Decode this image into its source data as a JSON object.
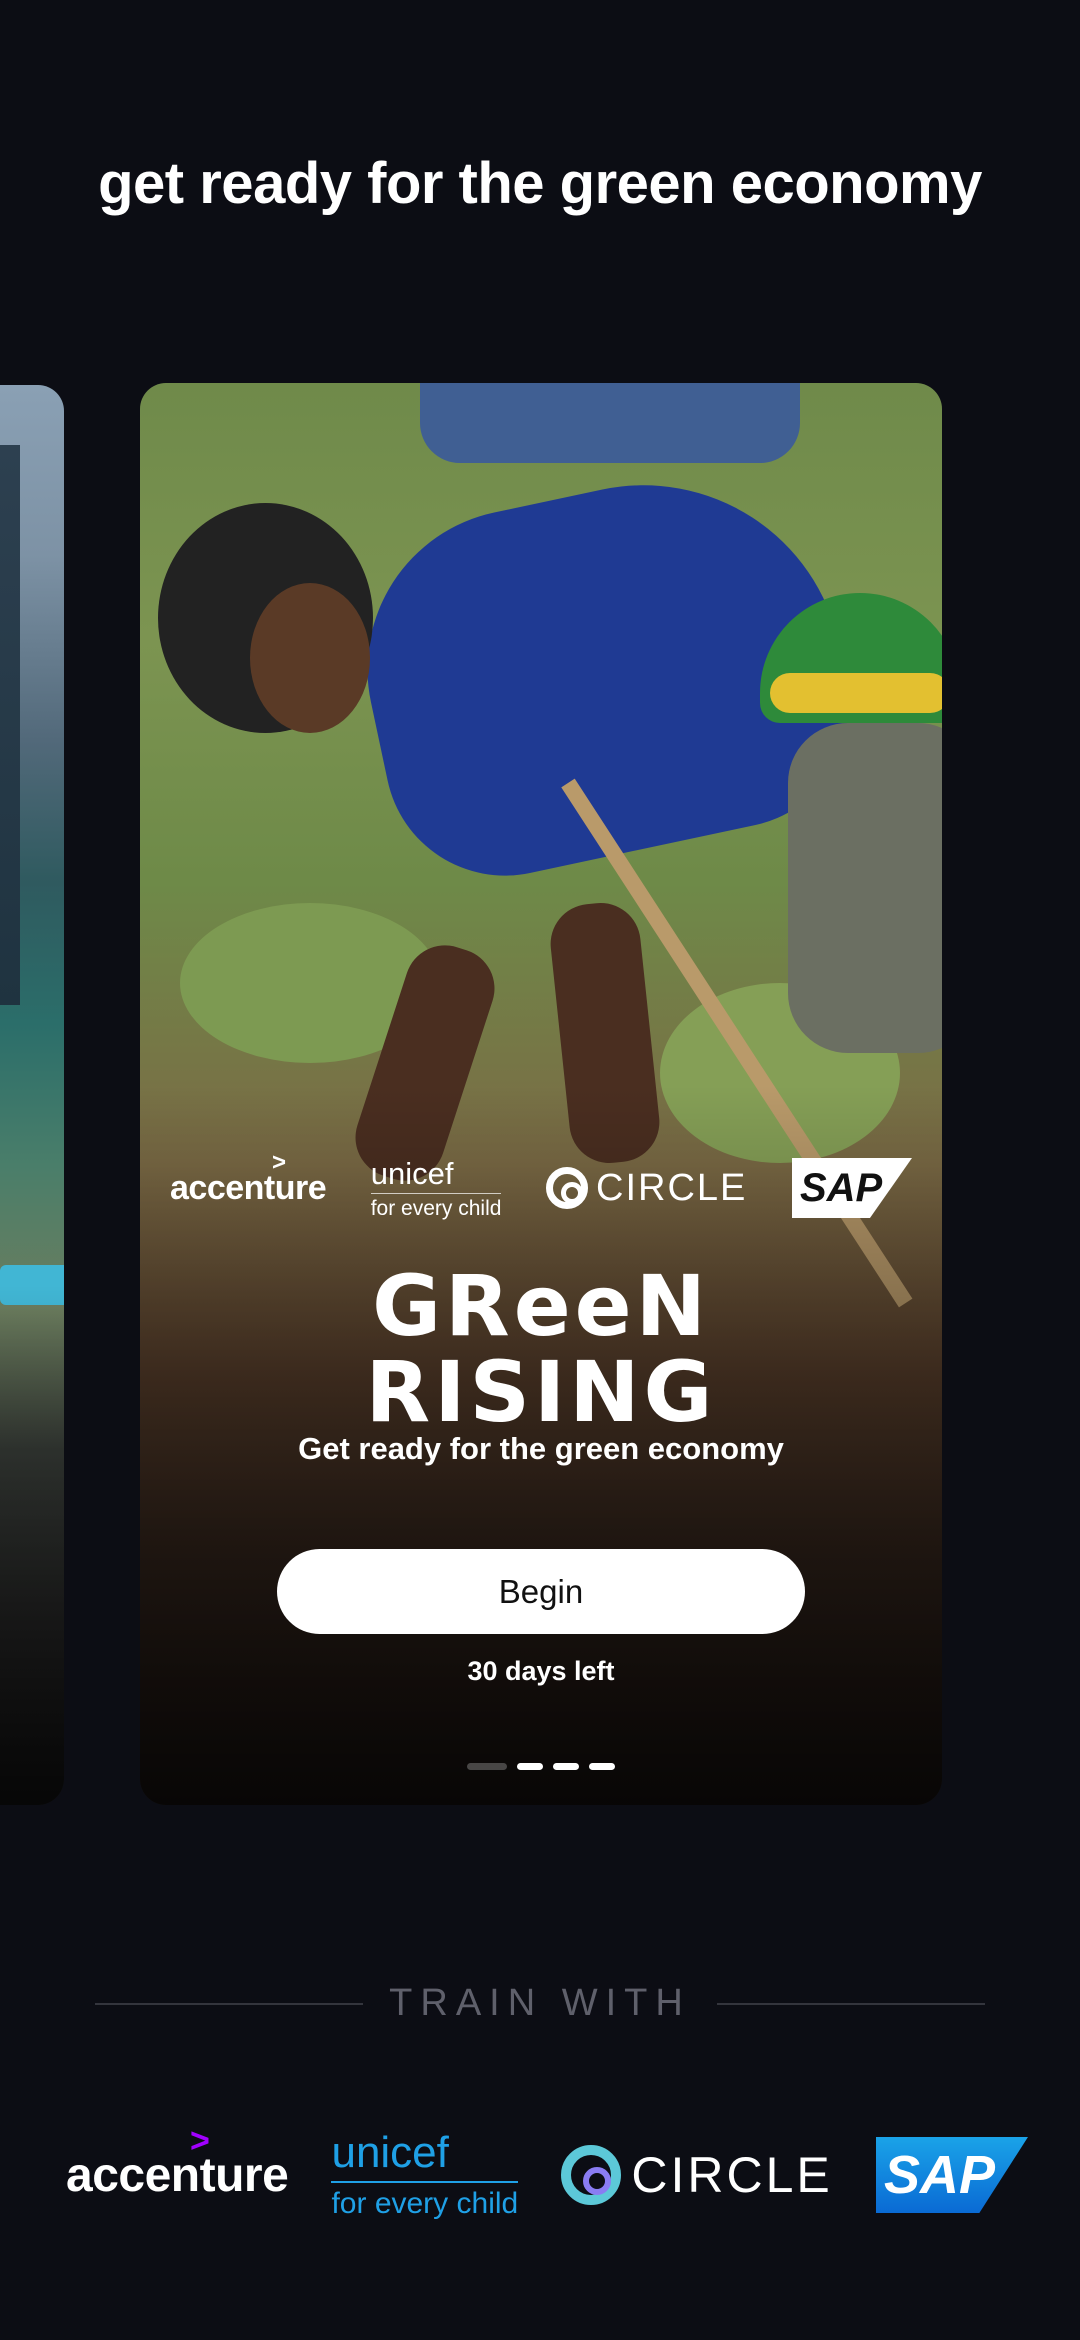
{
  "page": {
    "headline": "get ready for the green economy"
  },
  "card": {
    "partners": [
      "accenture",
      "unicef",
      "CIRCLE",
      "SAP"
    ],
    "unicef_tagline": "for every child",
    "brand_line1": "GReeN",
    "brand_line2": "RISING",
    "subtitle": "Get ready for the green economy",
    "button_label": "Begin",
    "days_left": "30 days left",
    "pagination": {
      "count": 4,
      "active": [
        1,
        2,
        3
      ]
    }
  },
  "train_with": {
    "label": "TRAIN WITH",
    "logos": {
      "accenture": "accenture",
      "unicef": "unicef",
      "unicef_tagline": "for every child",
      "circle": "CIRCLE",
      "sap": "SAP"
    },
    "colors": {
      "accenture_caret": "#a100ff",
      "unicef": "#1fa0e6",
      "circle_outer": "#5cc8d8",
      "circle_inner": "#8a7cf2",
      "sap": "#0a6ad4"
    }
  },
  "colors": {
    "background": "#0c0d14",
    "button": "#ffffff"
  },
  "icons": [
    "accenture-logo",
    "unicef-logo",
    "circle-logo",
    "sap-logo"
  ]
}
